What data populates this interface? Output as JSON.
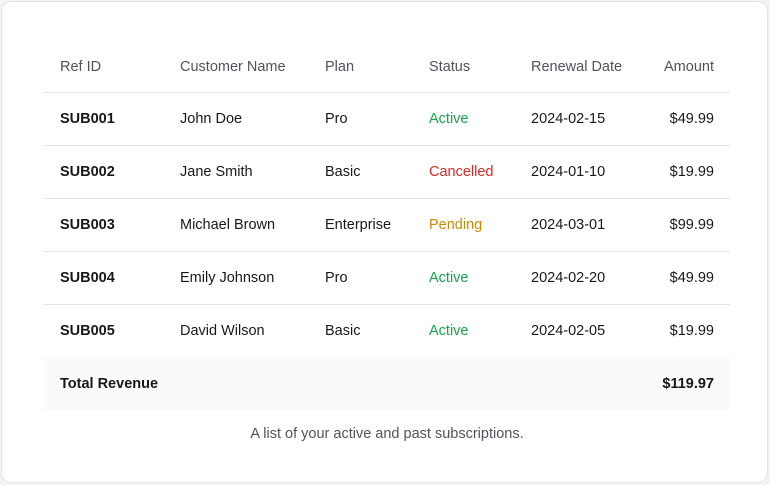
{
  "table": {
    "headers": {
      "ref_id": "Ref ID",
      "customer_name": "Customer Name",
      "plan": "Plan",
      "status": "Status",
      "renewal_date": "Renewal Date",
      "amount": "Amount"
    },
    "rows": [
      {
        "ref_id": "SUB001",
        "customer_name": "John Doe",
        "plan": "Pro",
        "status": "Active",
        "renewal_date": "2024-02-15",
        "amount": "$49.99"
      },
      {
        "ref_id": "SUB002",
        "customer_name": "Jane Smith",
        "plan": "Basic",
        "status": "Cancelled",
        "renewal_date": "2024-01-10",
        "amount": "$19.99"
      },
      {
        "ref_id": "SUB003",
        "customer_name": "Michael Brown",
        "plan": "Enterprise",
        "status": "Pending",
        "renewal_date": "2024-03-01",
        "amount": "$99.99"
      },
      {
        "ref_id": "SUB004",
        "customer_name": "Emily Johnson",
        "plan": "Pro",
        "status": "Active",
        "renewal_date": "2024-02-20",
        "amount": "$49.99"
      },
      {
        "ref_id": "SUB005",
        "customer_name": "David Wilson",
        "plan": "Basic",
        "status": "Active",
        "renewal_date": "2024-02-05",
        "amount": "$19.99"
      }
    ],
    "footer": {
      "label": "Total Revenue",
      "amount": "$119.97"
    },
    "caption": "A list of your active and past subscriptions."
  },
  "colors": {
    "status_active": "#16a34a",
    "status_cancelled": "#dc2626",
    "status_pending": "#ca8a04"
  }
}
